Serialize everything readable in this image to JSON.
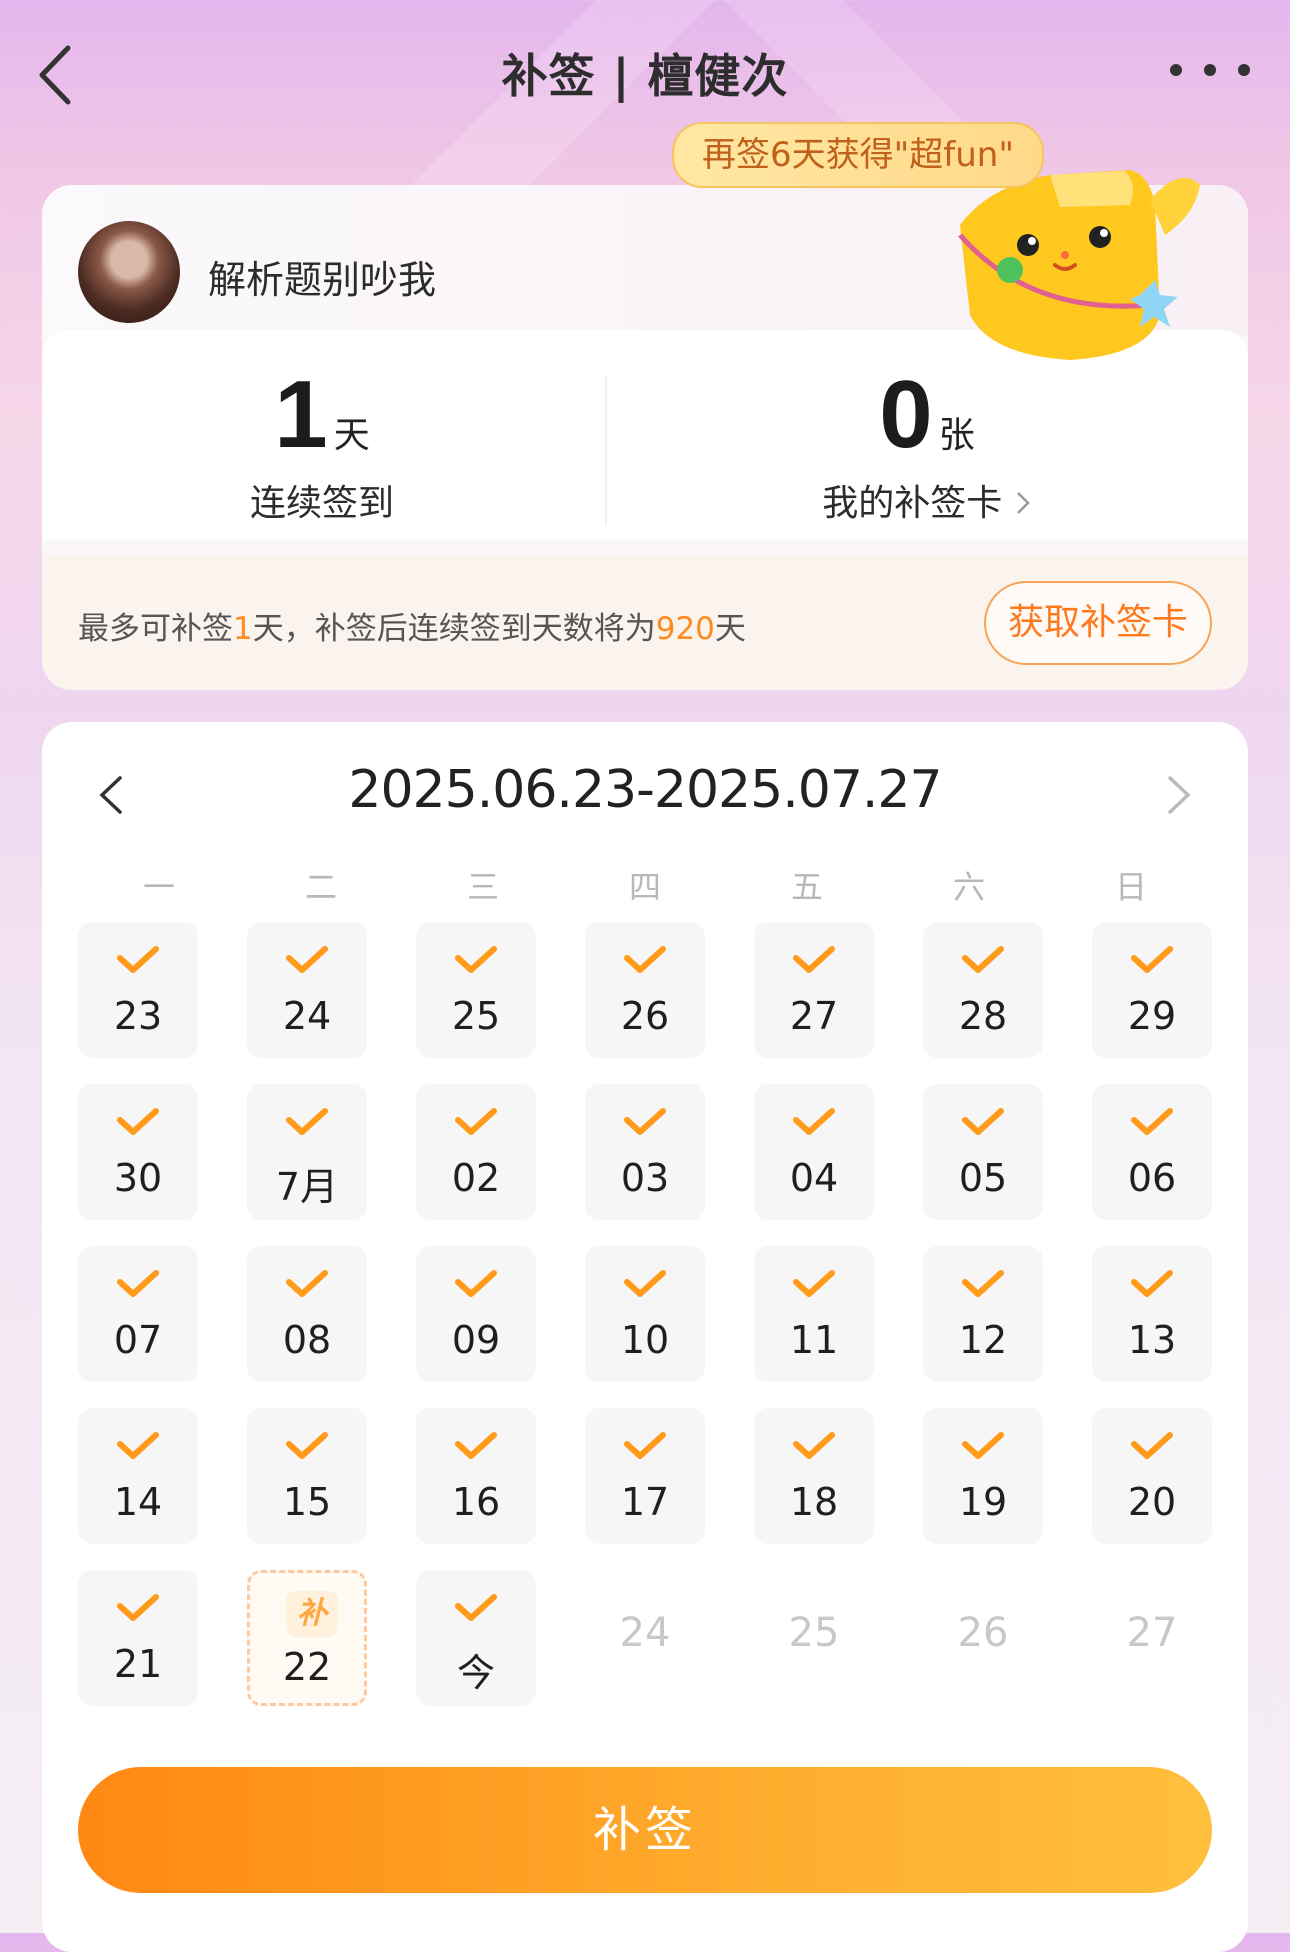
{
  "header": {
    "title": "补签 | 檀健次"
  },
  "badge": {
    "text": "再签6天获得\"超fun\""
  },
  "profile": {
    "username": "解析题别吵我"
  },
  "stats": {
    "streak_value": "1",
    "streak_unit": "天",
    "streak_label": "连续签到",
    "cards_value": "0",
    "cards_unit": "张",
    "cards_label": "我的补签卡"
  },
  "tip": {
    "part1": "最多可补签",
    "days": "1",
    "part2": "天，补签后连续签到天数将为",
    "total": "920",
    "part3": "天",
    "button": "获取补签卡"
  },
  "calendar": {
    "range": "2025.06.23-2025.07.27",
    "weekdays": [
      "一",
      "二",
      "三",
      "四",
      "五",
      "六",
      "日"
    ],
    "days": [
      {
        "label": "23",
        "state": "checked"
      },
      {
        "label": "24",
        "state": "checked"
      },
      {
        "label": "25",
        "state": "checked"
      },
      {
        "label": "26",
        "state": "checked"
      },
      {
        "label": "27",
        "state": "checked"
      },
      {
        "label": "28",
        "state": "checked"
      },
      {
        "label": "29",
        "state": "checked"
      },
      {
        "label": "30",
        "state": "checked"
      },
      {
        "label": "7月",
        "state": "checked"
      },
      {
        "label": "02",
        "state": "checked"
      },
      {
        "label": "03",
        "state": "checked"
      },
      {
        "label": "04",
        "state": "checked"
      },
      {
        "label": "05",
        "state": "checked"
      },
      {
        "label": "06",
        "state": "checked"
      },
      {
        "label": "07",
        "state": "checked"
      },
      {
        "label": "08",
        "state": "checked"
      },
      {
        "label": "09",
        "state": "checked"
      },
      {
        "label": "10",
        "state": "checked"
      },
      {
        "label": "11",
        "state": "checked"
      },
      {
        "label": "12",
        "state": "checked"
      },
      {
        "label": "13",
        "state": "checked"
      },
      {
        "label": "14",
        "state": "checked"
      },
      {
        "label": "15",
        "state": "checked"
      },
      {
        "label": "16",
        "state": "checked"
      },
      {
        "label": "17",
        "state": "checked"
      },
      {
        "label": "18",
        "state": "checked"
      },
      {
        "label": "19",
        "state": "checked"
      },
      {
        "label": "20",
        "state": "checked"
      },
      {
        "label": "21",
        "state": "checked"
      },
      {
        "label": "22",
        "state": "makeup",
        "badge": "补"
      },
      {
        "label": "今",
        "state": "checked"
      },
      {
        "label": "24",
        "state": "future"
      },
      {
        "label": "25",
        "state": "future"
      },
      {
        "label": "26",
        "state": "future"
      },
      {
        "label": "27",
        "state": "future"
      }
    ],
    "submit_label": "补签"
  },
  "colors": {
    "accent": "#ff8a1e",
    "check": "#ff9a1a",
    "future_text": "#c8c8c8"
  },
  "icons": [
    "back-arrow-icon",
    "more-dots-icon",
    "chevron-right-icon",
    "chevron-left-icon",
    "checkmark-icon",
    "mascot-illustration"
  ]
}
